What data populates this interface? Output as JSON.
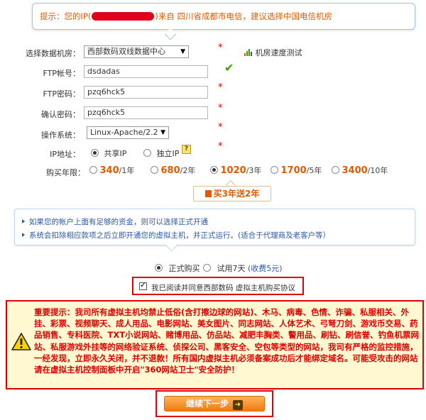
{
  "tip": {
    "label": "提示：",
    "before_ip": "您的IP(",
    "after_ip": ")来自 四川省成都市电信，建议选择中国电信机房"
  },
  "form": {
    "datacenter": {
      "label": "选择数据机房：",
      "value": "西部数码双线数据中心",
      "speed_test": "机房速度测试"
    },
    "ftp_account": {
      "label": "FTP帐号：",
      "value": "dsdadas"
    },
    "ftp_password": {
      "label": "FTP密码：",
      "value": "pzq6hck5"
    },
    "confirm_password": {
      "label": "确认密码：",
      "value": "pzq6hck5"
    },
    "os": {
      "label": "操作系统：",
      "value": "Linux-Apache/2.2"
    },
    "ip": {
      "label": "IP地址：",
      "options": [
        {
          "label": "共享IP",
          "selected": true
        },
        {
          "label": "独立IP",
          "selected": false
        }
      ],
      "help": "?"
    },
    "years": {
      "label": "购买年限：",
      "options": [
        {
          "price": "340",
          "unit": "/1年",
          "selected": false
        },
        {
          "price": "680",
          "unit": "/2年",
          "selected": false
        },
        {
          "price": "1020",
          "unit": "/3年",
          "selected": true
        },
        {
          "price": "1700",
          "unit": "/5年",
          "selected": false
        },
        {
          "price": "3400",
          "unit": "/10年",
          "selected": false
        }
      ]
    },
    "required_mark": "*"
  },
  "promo": "买3年送2年",
  "info": {
    "line1": "如果您的帐户上面有足够的资金，则可以选择正式开通",
    "line2": "系统会扣除相应款项之后立即开通您的虚拟主机，并正式运行。(适合于代理商及老客户等）"
  },
  "purchase_mode": {
    "formal": "正式购买",
    "trial": "试用7天",
    "trial_fee": "(收费5元)"
  },
  "agree": "我已阅读并同意西部数码 虚拟主机购买协议",
  "warning": "重要提示：我司所有虚拟主机均禁止低俗(含打擦边球的网站)、木马、病毒、色情、诈骗、私服相关、外挂、彩票、视频聊天、成人用品、电影网站、美女图片、同志网站、人体艺术、弓弩刀剑、游戏币交易、药品销售、专科医院、TXT小说网站、赌博用品、仿品站、减肥丰胸类、警用品、刷钻、刷信誉、钓鱼机票网站、私服游戏外挂等的网络验证系统、侦探公司、黑客安全、空包等类型的网站，我司有严格的监控措施，一经发现，立即永久关闭，并不退款！所有国内虚拟主机必须备案成功后才能绑定域名。可能受攻击的网站请在虚拟主机控制面板中开启\"360网站卫士\"安全防护！",
  "next_button": "继续下一步",
  "colors": {
    "accent": "#e05a00",
    "alert": "#e00000",
    "link": "#2a58a6",
    "ok": "#3aa000"
  }
}
